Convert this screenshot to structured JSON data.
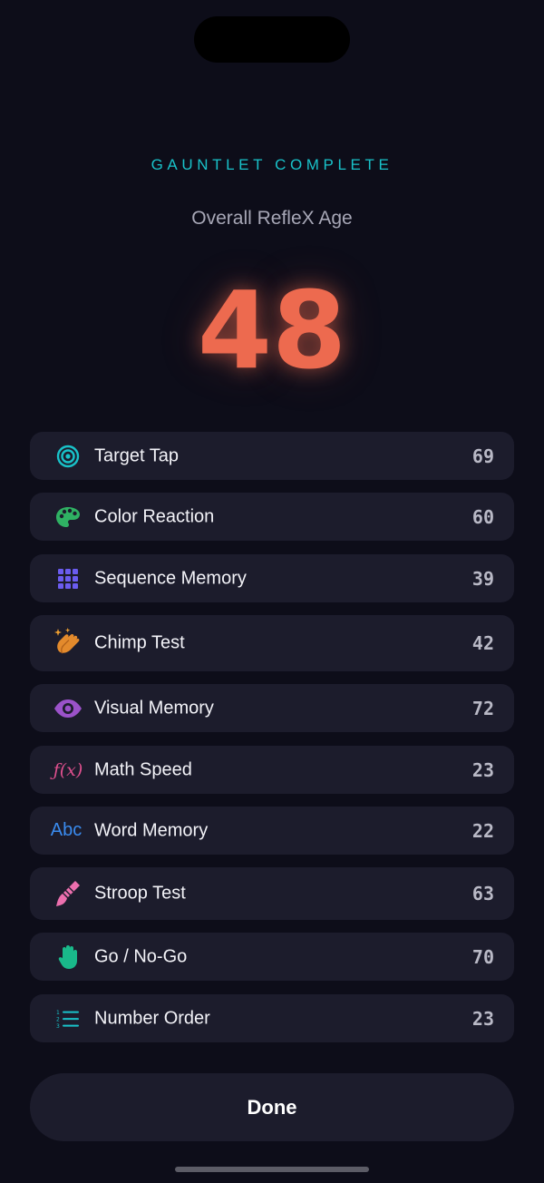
{
  "header": {
    "eyebrow": "GAUNTLET COMPLETE",
    "subtitle": "Overall RefleX Age",
    "overall_age": "48"
  },
  "colors": {
    "background": "#0d0d19",
    "card": "#1c1c2c",
    "accent_teal": "#19c2c9",
    "age_orange": "#ed6a4f"
  },
  "tests": [
    {
      "label": "Target Tap",
      "score": "69",
      "icon": "target-icon"
    },
    {
      "label": "Color Reaction",
      "score": "60",
      "icon": "palette-icon"
    },
    {
      "label": "Sequence Memory",
      "score": "39",
      "icon": "grid-icon"
    },
    {
      "label": "Chimp Test",
      "score": "42",
      "icon": "clapping-hands-icon"
    },
    {
      "label": "Visual Memory",
      "score": "72",
      "icon": "eye-icon"
    },
    {
      "label": "Math Speed",
      "score": "23",
      "icon": "function-icon",
      "icon_text": "ƒ(x)"
    },
    {
      "label": "Word Memory",
      "score": "22",
      "icon": "text-abc-icon",
      "icon_text": "Abc"
    },
    {
      "label": "Stroop Test",
      "score": "63",
      "icon": "paintbrush-icon"
    },
    {
      "label": "Go / No-Go",
      "score": "70",
      "icon": "raised-hand-icon"
    },
    {
      "label": "Number Order",
      "score": "23",
      "icon": "numbered-list-icon"
    }
  ],
  "actions": {
    "done_label": "Done"
  }
}
